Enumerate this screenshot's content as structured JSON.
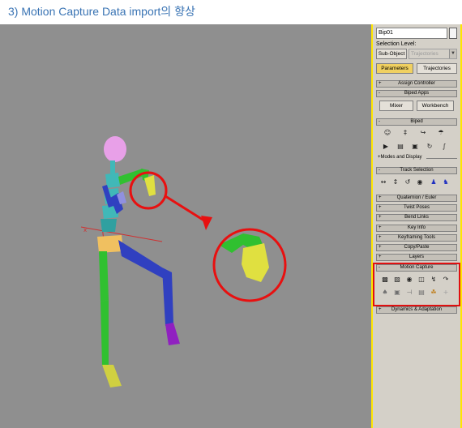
{
  "heading": "3) Motion Capture Data import의 향상",
  "panel": {
    "object_name": "Bip01",
    "selection_level_label": "Selection Level:",
    "subobject_button": "Sub-Object",
    "trajectories_select": "Trajectories",
    "tabs": [
      "Parameters",
      "Trajectories"
    ],
    "rollouts": {
      "assign_controller": "Assign Controller",
      "biped_apps": "Biped Apps",
      "biped": "Biped",
      "track_selection": "Track Selection",
      "quaternion_euler": "Quaternion / Euler",
      "twist_poses": "Twist Poses",
      "bend_links": "Bend Links",
      "key_info": "Key Info",
      "keyframing_tools": "Keyframing Tools",
      "copy_paste": "Copy/Paste",
      "layers": "Layers",
      "motion_capture": "Motion Capture",
      "dynamics_adaptation": "Dynamics & Adaptation"
    },
    "buttons": {
      "mixer": "Mixer",
      "workbench": "Workbench"
    },
    "modes_and_display": "+Modes and Display",
    "icons": {
      "biped_row1": [
        "figure-mode-icon",
        "footstep-mode-icon",
        "motion-flow-icon",
        "mixer-mode-icon"
      ],
      "biped_row2": [
        "play-biped-icon",
        "load-file-icon",
        "save-file-icon",
        "convert-icon",
        "move-all-icon"
      ],
      "track_selection": [
        "body-horizontal-icon",
        "body-vertical-icon",
        "body-rotation-icon",
        "lock-cog-icon",
        "symmetrical-icon",
        "opposite-icon"
      ],
      "motion_capture_row1": [
        "load-mocap-icon",
        "convert-mocap-icon",
        "load-marker-icon",
        "camera-marker-icon",
        "talent-figure-icon",
        "batch-file-icon"
      ],
      "motion_capture_row2": [
        "show-markers-icon",
        "adjust-talent-icon",
        "save-talent-icon",
        "talent-pose-icon",
        "paste-colors-icon",
        "marker-add-icon"
      ]
    },
    "colors": {
      "accent_yellow": "#ffe600",
      "active_tab": "#f0d060",
      "highlight_red": "#e01010"
    }
  },
  "viewport": {
    "background": "#8f8f8f",
    "callout_color": "#e81010"
  }
}
